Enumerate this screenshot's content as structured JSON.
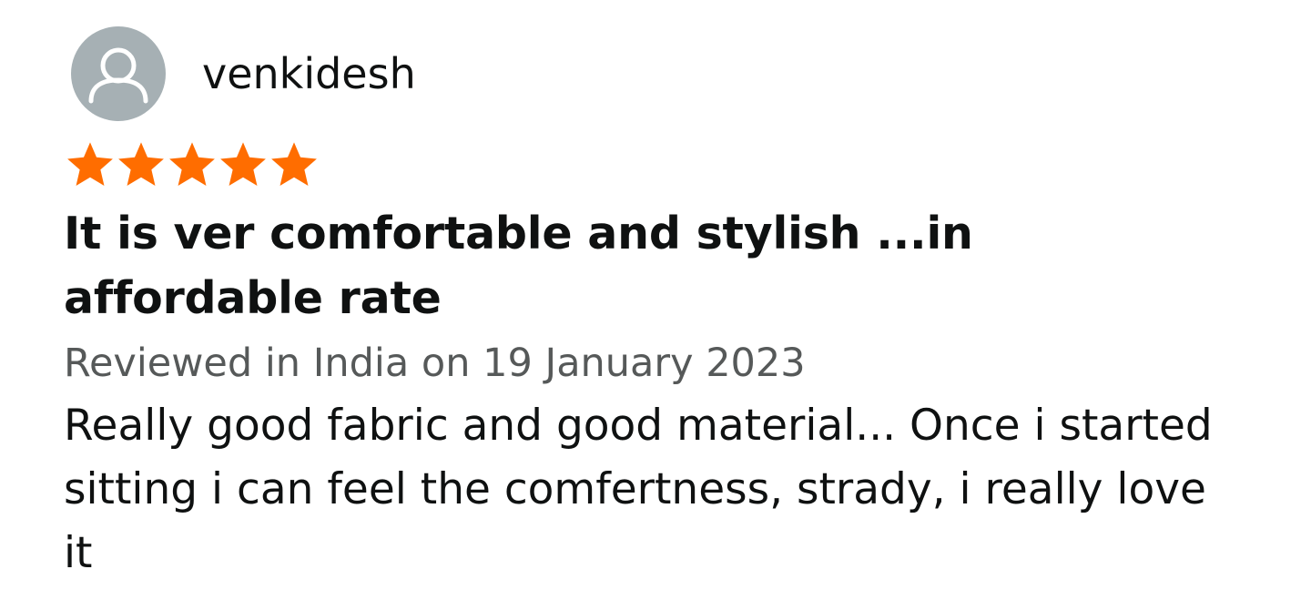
{
  "review": {
    "reviewer": {
      "name": "venkidesh",
      "avatar_icon": "default-profile-avatar-icon"
    },
    "rating": {
      "value": 5,
      "max": 5,
      "star_icon": "star-filled-icon",
      "star_color": "#ff6d00"
    },
    "title": "It is ver comfortable and stylish ...in affordable rate",
    "date_text": "Reviewed in India on 19 January 2023",
    "body": "Really good fabric and good material... Once i started sitting i can feel the comfertness, strady, i really love it"
  },
  "colors": {
    "text_primary": "#0f1111",
    "text_secondary": "#565959",
    "avatar_bg": "#a6b0b4",
    "avatar_fg": "#ffffff"
  }
}
